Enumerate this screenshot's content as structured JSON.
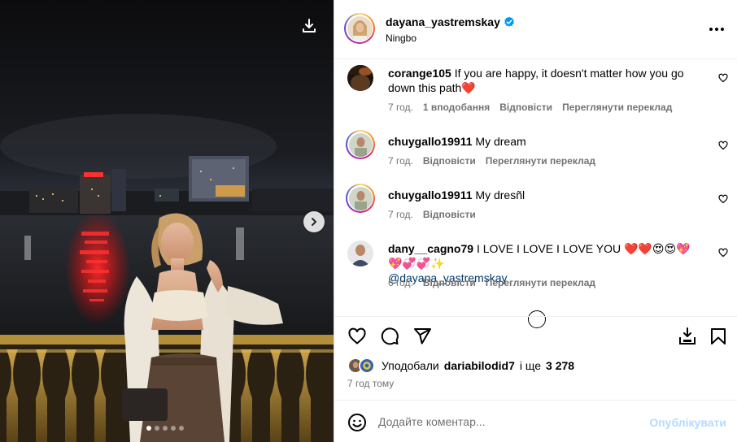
{
  "post": {
    "author": "dayana_yastremskay",
    "location": "Ningbo"
  },
  "comments": [
    {
      "user": "corange105",
      "text": "If you are happy, it doesn't matter how you go down this path❤️",
      "time": "7 год.",
      "likes": "1 вподобання",
      "reply": "Відповісти",
      "translate": "Переглянути переклад"
    },
    {
      "user": "chuygallo19911",
      "text": "My dream",
      "time": "7 год.",
      "reply": "Відповісти",
      "translate": "Переглянути переклад"
    },
    {
      "user": "chuygallo19911",
      "text": "My dresñl",
      "time": "7 год.",
      "reply": "Відповісти"
    },
    {
      "user": "dany__cagno79",
      "text": "I LOVE I LOVE I LOVE YOU ❤️❤️😍😍💖💖💞💞✨",
      "mention": "@dayana_yastremskay",
      "time": "6 год.",
      "reply": "Відповісти",
      "translate": "Переглянути переклад"
    }
  ],
  "likes": {
    "prefix": "Уподобали",
    "user": "dariabilodid7",
    "suffix": "і ще",
    "count": "3 278"
  },
  "time_ago": "7 год тому",
  "comment_box": {
    "placeholder": "Додайте коментар...",
    "publish": "Опублікувати"
  },
  "carousel": {
    "slides": 5,
    "active": 1
  },
  "colors": {
    "link": "#00376b",
    "verified": "#0095f6",
    "publish_disabled": "#b3dbff",
    "muted": "#737373"
  }
}
